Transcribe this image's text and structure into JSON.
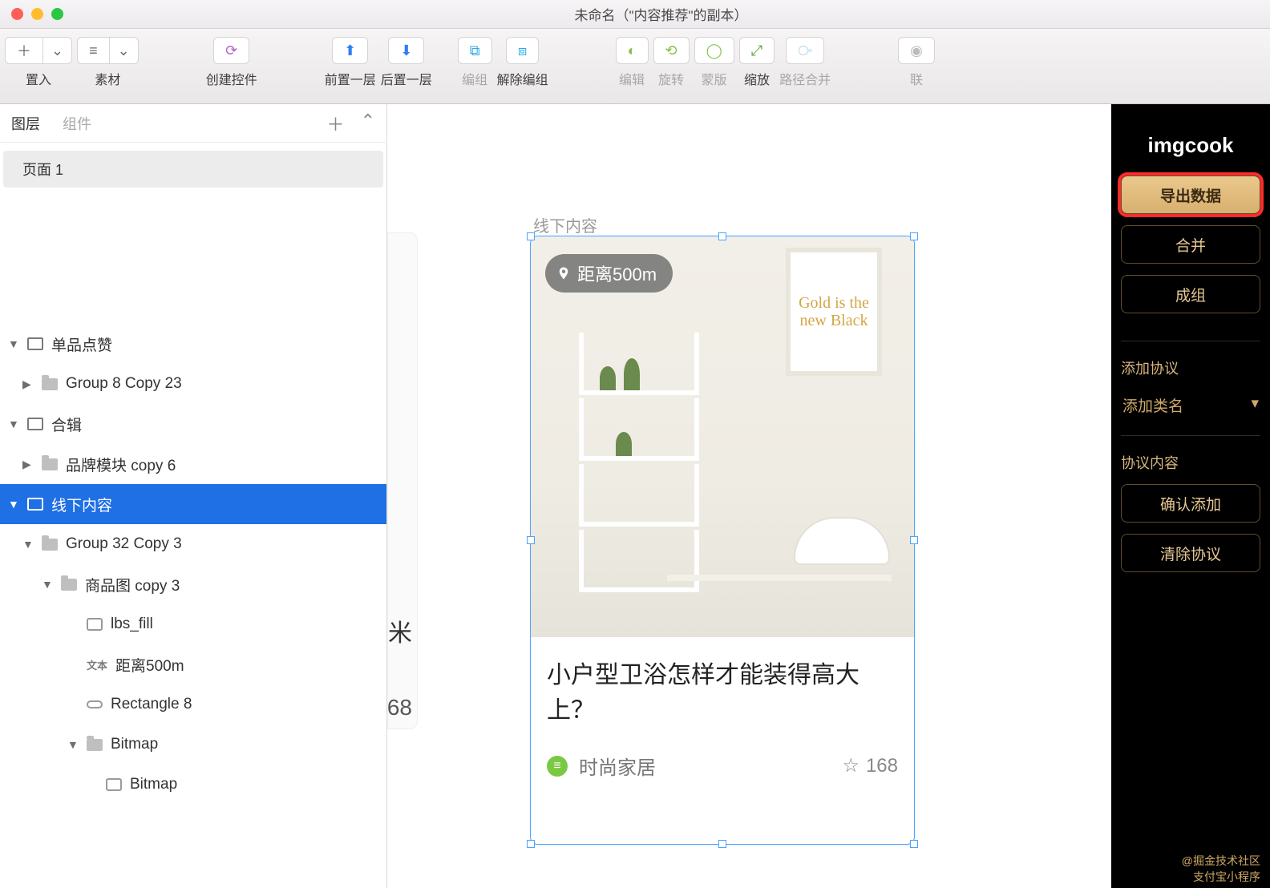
{
  "window": {
    "title": "未命名（\"内容推荐\"的副本）"
  },
  "toolbar": {
    "insert": "置入",
    "assets": "素材",
    "create_ctrl": "创建控件",
    "bring_forward": "前置一层",
    "send_backward": "后置一层",
    "group": "编组",
    "ungroup": "解除编组",
    "edit": "编辑",
    "rotate": "旋转",
    "mask": "蒙版",
    "scale": "缩放",
    "path_merge": "路径合并",
    "union_cut": "联"
  },
  "left": {
    "tab_layers": "图层",
    "tab_components": "组件",
    "page": "页面 1",
    "tree": {
      "n0": "单品点赞",
      "n0_0": "Group 8 Copy 23",
      "n1": "合辑",
      "n1_0": "品牌模块 copy 6",
      "n2": "线下内容",
      "n2_0": "Group 32 Copy 3",
      "n2_0_0": "商品图 copy 3",
      "n2_0_0_0": "lbs_fill",
      "n2_0_0_1": "距离500m",
      "n2_0_0_2": "Rectangle 8",
      "n2_0_0_3": "Bitmap",
      "n2_0_0_3_0": "Bitmap"
    }
  },
  "canvas": {
    "artboard_label": "线下内容",
    "peek_char": "米",
    "peek_num": "68",
    "card": {
      "badge": "距离500m",
      "frame_text": "Gold is the new Black",
      "title": "小户型卫浴怎样才能装得高大上？",
      "tag": "时尚家居",
      "likes": "168"
    }
  },
  "right": {
    "logo": "imgcook",
    "export": "导出数据",
    "merge": "合并",
    "group": "成组",
    "add_protocol": "添加协议",
    "add_class": "添加类名",
    "protocol_content": "协议内容",
    "confirm_add": "确认添加",
    "clear_protocol": "清除协议",
    "footer1": "@掘金技术社区",
    "footer2": "支付宝小程序"
  }
}
